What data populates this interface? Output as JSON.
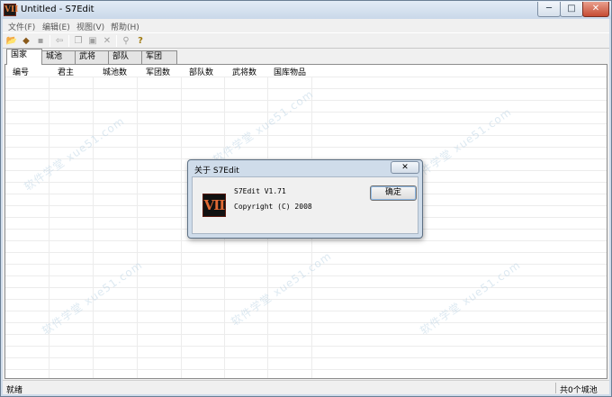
{
  "window": {
    "title": "Untitled - S7Edit",
    "icon_text": "VII"
  },
  "window_controls": {
    "minimize": "─",
    "maximize": "□",
    "close": "✕"
  },
  "menu": [
    {
      "label": "文件(F)"
    },
    {
      "label": "编辑(E)"
    },
    {
      "label": "视图(V)"
    },
    {
      "label": "帮助(H)"
    }
  ],
  "toolbar": {
    "open_glyph": "📂",
    "tag_glyph": "◆",
    "save_glyph": "▪",
    "back_glyph": "⇦",
    "copy_glyph": "❐",
    "paste_glyph": "▣",
    "delete_glyph": "✕",
    "find_glyph": "⚲",
    "help_glyph": "?"
  },
  "tabs": [
    {
      "label": "国家",
      "active": true
    },
    {
      "label": "城池",
      "active": false
    },
    {
      "label": "武将",
      "active": false
    },
    {
      "label": "部队",
      "active": false
    },
    {
      "label": "军团",
      "active": false
    }
  ],
  "table": {
    "columns": [
      "编号",
      "君主",
      "城池数",
      "军团数",
      "部队数",
      "武将数",
      "国库物品"
    ],
    "rows": []
  },
  "status": {
    "left": "就绪",
    "right": "共0个城池"
  },
  "watermark": {
    "text": "软件学堂 xue51.com"
  },
  "about_dialog": {
    "title": "关于 S7Edit",
    "close_glyph": "✕",
    "logo_text": "VII",
    "version": "S7Edit V1.71",
    "copyright": "Copyright (C) 2008",
    "ok_label": "确定"
  },
  "colors": {
    "accent": "#8fb9e4",
    "frame": "#cfdcea",
    "close": "#c64b33"
  }
}
